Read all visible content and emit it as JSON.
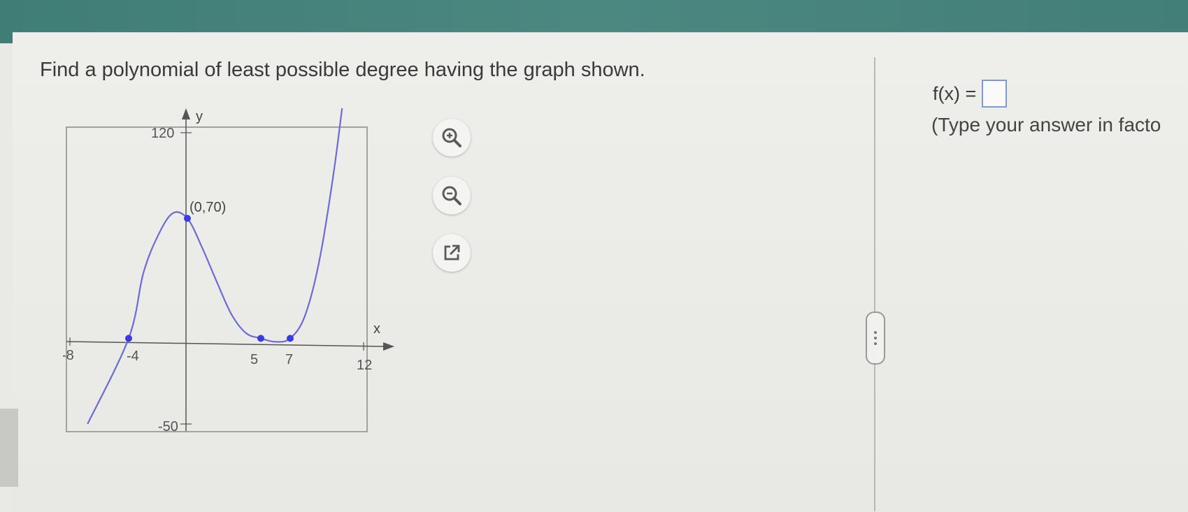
{
  "question": {
    "text": "Find a polynomial of least possible degree having the graph shown."
  },
  "graph": {
    "y_axis_label": "y",
    "x_axis_label": "x",
    "y_max_label": "120",
    "y_min_label": "-50",
    "x_min_label": "-8",
    "x_max_label": "12",
    "point_labels": [
      "-4",
      "5",
      "7"
    ],
    "intercept_label": "(0,70)",
    "colors": {
      "curve": "#6b6bd6",
      "point": "#3a3ae0",
      "axis": "#555555",
      "frame": "#8a8a8a"
    }
  },
  "chart_data": {
    "type": "line",
    "xlabel": "x",
    "ylabel": "y",
    "xlim": [
      -8,
      12
    ],
    "ylim": [
      -50,
      120
    ],
    "series": [
      {
        "x": [
          -6.8,
          -4,
          -3,
          -2,
          -1,
          0,
          1,
          2,
          3,
          4,
          5,
          6,
          7,
          8,
          9,
          10,
          10.8
        ],
        "values": [
          -50,
          0,
          38,
          60,
          73,
          70,
          53,
          33,
          14,
          3,
          0,
          -2,
          0,
          13,
          46,
          99,
          153
        ]
      }
    ],
    "points": [
      {
        "x": -4,
        "y": 0
      },
      {
        "x": 0,
        "y": 70
      },
      {
        "x": 5,
        "y": 0
      },
      {
        "x": 7,
        "y": 0
      }
    ]
  },
  "tools": {
    "zoom_in_icon": "zoom-in-icon",
    "zoom_out_icon": "zoom-out-icon",
    "popout_icon": "external-link-icon"
  },
  "answer": {
    "label": "f(x) =",
    "value": "",
    "hint": "(Type your answer in facto"
  }
}
